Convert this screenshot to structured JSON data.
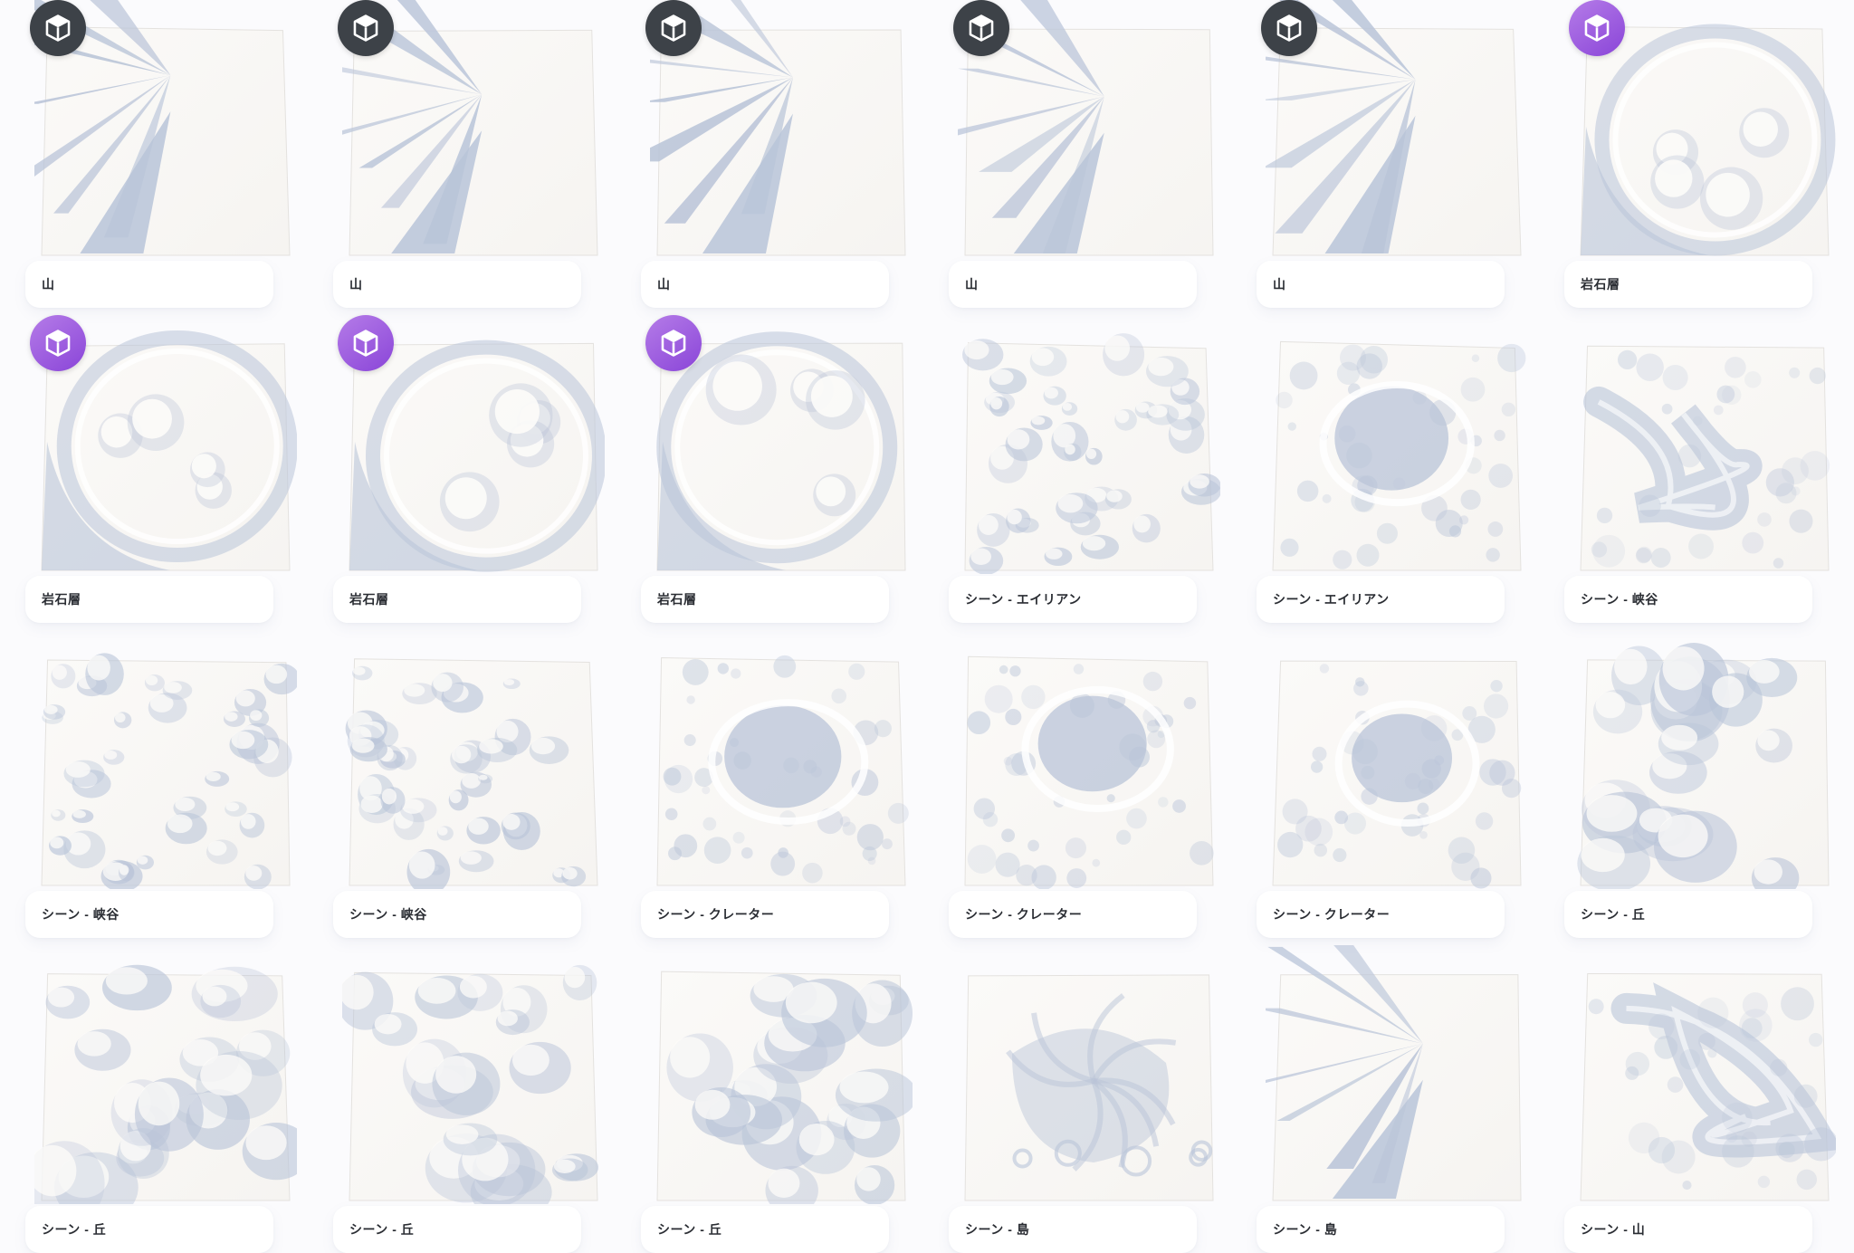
{
  "gallery": {
    "items": [
      {
        "label": "山",
        "badge": "dark",
        "badge_icon": "cube-icon",
        "terrain": "mountain"
      },
      {
        "label": "山",
        "badge": "dark",
        "badge_icon": "cube-icon",
        "terrain": "mountain"
      },
      {
        "label": "山",
        "badge": "dark",
        "badge_icon": "cube-icon",
        "terrain": "mountain"
      },
      {
        "label": "山",
        "badge": "dark",
        "badge_icon": "cube-icon",
        "terrain": "mountain"
      },
      {
        "label": "山",
        "badge": "dark",
        "badge_icon": "cube-icon",
        "terrain": "mountain"
      },
      {
        "label": "岩石層",
        "badge": "purple",
        "badge_icon": "cube-icon",
        "terrain": "crater-ring"
      },
      {
        "label": "岩石層",
        "badge": "purple",
        "badge_icon": "cube-icon",
        "terrain": "crater-ring"
      },
      {
        "label": "岩石層",
        "badge": "purple",
        "badge_icon": "cube-icon",
        "terrain": "crater-ring"
      },
      {
        "label": "岩石層",
        "badge": "purple",
        "badge_icon": "cube-icon",
        "terrain": "crater-ring"
      },
      {
        "label": "シーン - エイリアン",
        "badge": "none",
        "badge_icon": "",
        "terrain": "rough"
      },
      {
        "label": "シーン - エイリアン",
        "badge": "none",
        "badge_icon": "",
        "terrain": "crater"
      },
      {
        "label": "シーン - 峡谷",
        "badge": "none",
        "badge_icon": "",
        "terrain": "canyon"
      },
      {
        "label": "シーン - 峡谷",
        "badge": "none",
        "badge_icon": "",
        "terrain": "rough"
      },
      {
        "label": "シーン - 峡谷",
        "badge": "none",
        "badge_icon": "",
        "terrain": "rough"
      },
      {
        "label": "シーン - クレーター",
        "badge": "none",
        "badge_icon": "",
        "terrain": "crater"
      },
      {
        "label": "シーン - クレーター",
        "badge": "none",
        "badge_icon": "",
        "terrain": "crater"
      },
      {
        "label": "シーン - クレーター",
        "badge": "none",
        "badge_icon": "",
        "terrain": "crater"
      },
      {
        "label": "シーン - 丘",
        "badge": "none",
        "badge_icon": "",
        "terrain": "hills"
      },
      {
        "label": "シーン - 丘",
        "badge": "none",
        "badge_icon": "",
        "terrain": "hills"
      },
      {
        "label": "シーン - 丘",
        "badge": "none",
        "badge_icon": "",
        "terrain": "hills"
      },
      {
        "label": "シーン - 丘",
        "badge": "none",
        "badge_icon": "",
        "terrain": "hills"
      },
      {
        "label": "シーン - 島",
        "badge": "none",
        "badge_icon": "",
        "terrain": "island"
      },
      {
        "label": "シーン - 島",
        "badge": "none",
        "badge_icon": "",
        "terrain": "mountain"
      },
      {
        "label": "シーン - 山",
        "badge": "none",
        "badge_icon": "",
        "terrain": "canyon"
      }
    ]
  },
  "colors": {
    "page_background": "#fbfbfd",
    "terrain_light": "#f6f4f1",
    "terrain_shadow": "#b9c4d8",
    "badge_dark": "#3d4248",
    "badge_purple": "#9b5ae0",
    "label_text": "#2a2d33"
  }
}
